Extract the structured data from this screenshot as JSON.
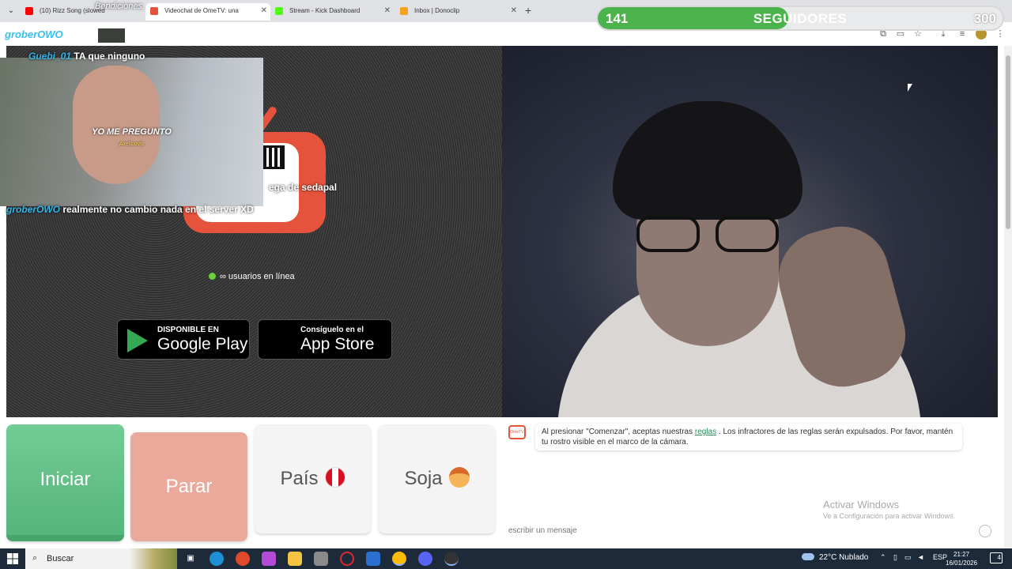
{
  "browser": {
    "tabs": [
      {
        "title": "(10) Rizz Song (slowed",
        "favicon_color": "#ff0000"
      },
      {
        "title": "Videochat de OmeTV: una",
        "favicon_color": "#e5533d"
      },
      {
        "title": "Stream - Kick Dashboard",
        "favicon_color": "#53fc18"
      },
      {
        "title": "Inbox | Donoclip",
        "favicon_color": "#f7a21b"
      }
    ],
    "new_tab_icon": "plus-icon"
  },
  "overlay": {
    "top_chat": "Bendiciones.",
    "kick_username": "groberOWO",
    "followers": {
      "current": "141",
      "label": "SEGUIDORES",
      "goal": "300",
      "progress": 0.47,
      "fill_color": "#4cb34c"
    },
    "webcam_text": "YO ME PREGUNTO",
    "webcam_subtext": "AxellLovis",
    "chat_lines": [
      {
        "user": "Guebi_01",
        "text": "TA que ninguno"
      },
      {
        "user": "",
        "text": "ega de sedapal"
      },
      {
        "user": "groberOWO",
        "text": "realmente no cambio nada en el server XD"
      }
    ]
  },
  "ometv": {
    "online_text": "∞ usuarios en línea",
    "google_play": {
      "small": "DISPONIBLE EN",
      "big": "Google Play"
    },
    "app_store": {
      "small": "Consíguelo en el",
      "big": "App Store"
    },
    "brand_color": "#e5533d"
  },
  "controls": {
    "start": "Iniciar",
    "stop": "Parar",
    "country": "País",
    "gender": "Soja"
  },
  "chat": {
    "system_before": "Al presionar \"Comenzar\", aceptas nuestras ",
    "system_link": "reglas",
    "system_after": " . Los infractores de las reglas serán expulsados. Por favor, mantén tu rostro visible en el marco de la cámara.",
    "input_placeholder": "escribir un mensaje",
    "watermark_title": "Activar Windows",
    "watermark_sub": "Ve a Configuración para activar Windows."
  },
  "taskbar": {
    "search_label": "Buscar",
    "weather": "22°C  Nublado",
    "language": "ESP",
    "time": "21:27",
    "date": "16/01/2026",
    "notifications": "4"
  }
}
